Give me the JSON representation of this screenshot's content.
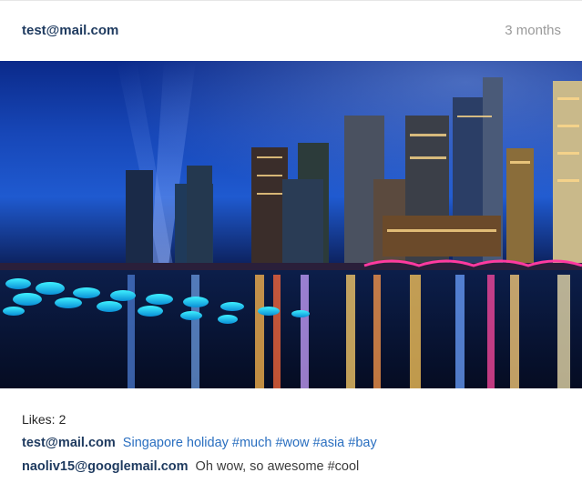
{
  "post": {
    "username": "test@mail.com",
    "age": "3 months",
    "likes_label": "Likes:",
    "likes_count": "2",
    "image_subject": "Singapore skyline at night reflected in bay with glowing blue lanterns"
  },
  "comments": [
    {
      "author": "test@mail.com",
      "text": "Singapore holiday #much #wow #asia #bay"
    },
    {
      "author": "naoliv15@googlemail.com",
      "text": "Oh wow, so awesome #cool"
    }
  ],
  "colors": {
    "username": "#1e3a5f",
    "caption": "#2a6fc0",
    "timestamp": "#9a9a9a"
  }
}
